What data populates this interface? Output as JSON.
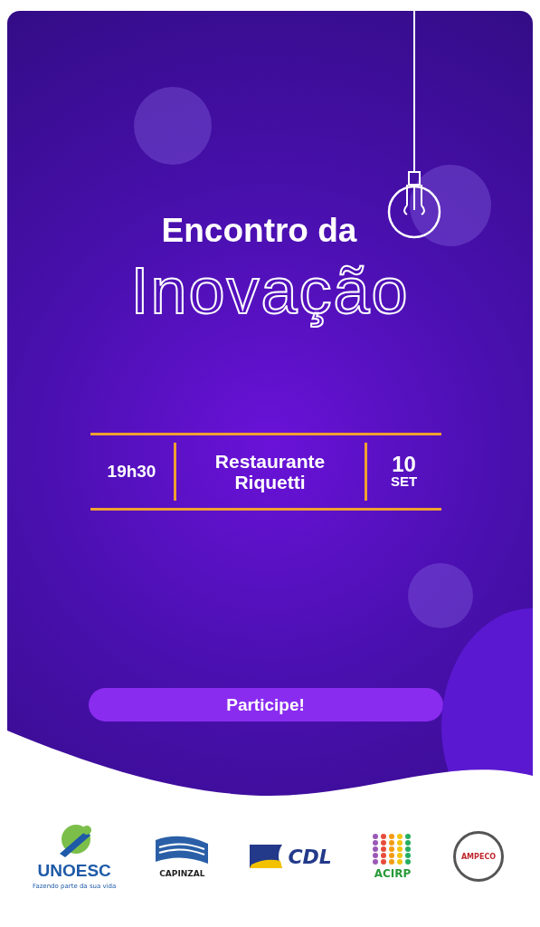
{
  "title": {
    "line_1": "Encontro da",
    "line_2": "Inovação"
  },
  "details": {
    "time": "19h30",
    "venue_lines": [
      "Restaurante",
      "Riquetti"
    ],
    "day": "10",
    "month": "SET"
  },
  "button": {
    "label": "Participe!"
  },
  "logos": [
    {
      "kind": "unoesc",
      "name": "UNOESC",
      "tagline": "Fazendo parte da sua vida"
    },
    {
      "kind": "flag",
      "name": "CAPINZAL"
    },
    {
      "kind": "cdl",
      "name": "CDL"
    },
    {
      "kind": "pixel",
      "name": "ACIRP"
    },
    {
      "kind": "badge",
      "name": "AMPECO"
    }
  ]
}
